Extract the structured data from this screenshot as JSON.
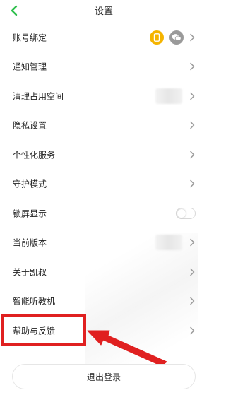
{
  "header": {
    "title": "设置"
  },
  "colors": {
    "accent_green": "#2dbf4b",
    "phone_badge": "#f5b400",
    "wechat_badge": "#9a9a9a",
    "annotation_red": "#e02020"
  },
  "rows": [
    {
      "label": "账号绑定",
      "accessory": "bind-icons",
      "icons": [
        "phone-icon",
        "wechat-icon"
      ]
    },
    {
      "label": "通知管理",
      "accessory": "chevron"
    },
    {
      "label": "清理占用空间",
      "accessory": "blurred-value"
    },
    {
      "label": "隐私设置",
      "accessory": "chevron"
    },
    {
      "label": "个性化服务",
      "accessory": "chevron"
    },
    {
      "label": "守护模式",
      "accessory": "chevron"
    },
    {
      "label": "锁屏显示",
      "accessory": "toggle",
      "toggle_on": false
    },
    {
      "label": "当前版本",
      "accessory": "blurred-value"
    },
    {
      "label": "关于凯叔",
      "accessory": "chevron"
    },
    {
      "label": "智能听教机",
      "accessory": "chevron"
    },
    {
      "label": "帮助与反馈",
      "accessory": "chevron",
      "highlighted": true
    }
  ],
  "logout": {
    "label": "退出登录"
  }
}
